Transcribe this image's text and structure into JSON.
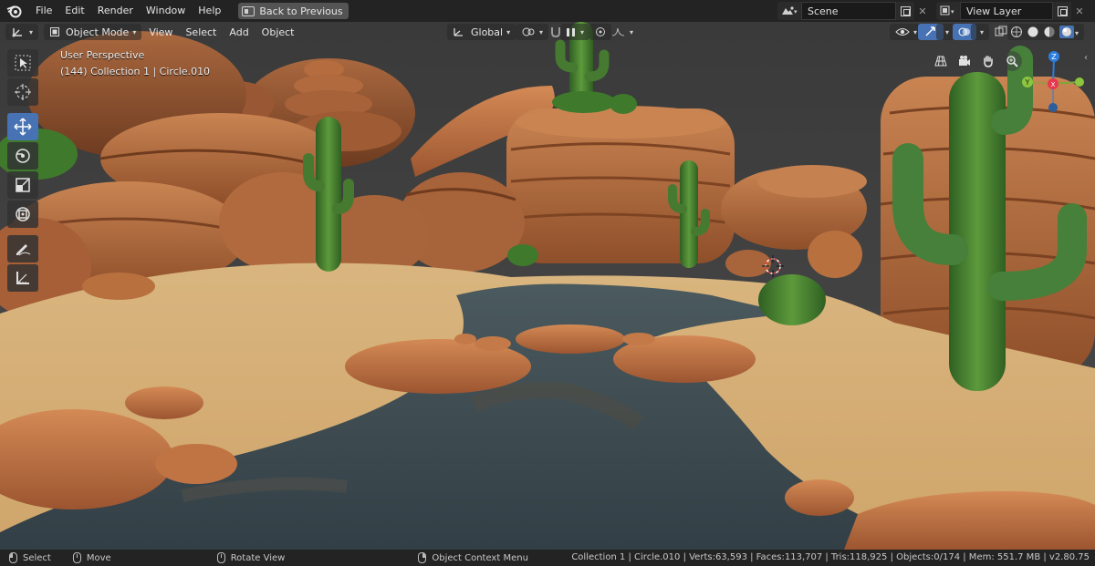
{
  "topbar": {
    "menus": [
      "File",
      "Edit",
      "Render",
      "Window",
      "Help"
    ],
    "back_label": "Back to Previous",
    "scene_name": "Scene",
    "view_layer": "View Layer"
  },
  "viewport_header": {
    "mode": "Object Mode",
    "menus": [
      "View",
      "Select",
      "Add",
      "Object"
    ],
    "transform_orientation": "Global"
  },
  "overlay": {
    "perspective": "User Perspective",
    "collection_info": "(144) Collection 1 | Circle.010"
  },
  "gizmo": {
    "z": "Z",
    "y": "Y",
    "x": "X"
  },
  "tools": [
    {
      "name": "select-box",
      "icon": "cursor-icon"
    },
    {
      "name": "cursor",
      "icon": "crosshair-icon"
    },
    {
      "name": "move",
      "icon": "move-arrows-icon",
      "active": true
    },
    {
      "name": "rotate",
      "icon": "rotate-icon"
    },
    {
      "name": "scale",
      "icon": "scale-icon"
    },
    {
      "name": "transform",
      "icon": "transform-icon"
    },
    {
      "name": "annotate",
      "icon": "pencil-icon"
    },
    {
      "name": "measure",
      "icon": "ruler-icon"
    }
  ],
  "statusbar": {
    "select": "Select",
    "move": "Move",
    "rotate": "Rotate View",
    "context": "Object Context Menu",
    "stats": "Collection 1 | Circle.010 | Verts:63,593 | Faces:113,707 | Tris:118,925 | Objects:0/174 | Mem: 551.7 MB | v2.80.75"
  },
  "colors": {
    "sky": "#3d3d3d",
    "sand": "#d8b27a",
    "rock": "#b8693c",
    "water": "#3e4d55",
    "cactus": "#4e8a35",
    "active_tool": "#4772b3"
  }
}
